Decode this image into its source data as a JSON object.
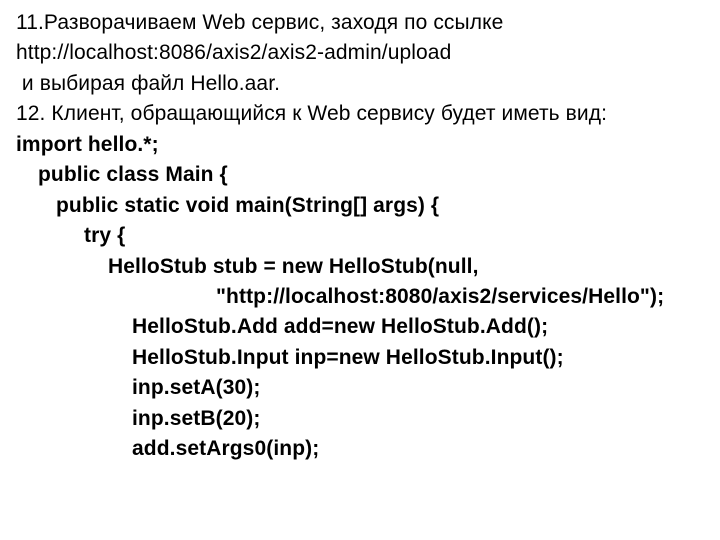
{
  "doc": {
    "line1": "11.Разворачиваем Web сервис, заходя по ссылке",
    "line2": "http://localhost:8086/axis2/axis2-admin/upload",
    "line3": " и выбирая файл Hello.aar.",
    "line4": "12. Клиент, обращающийся к Web сервису будет иметь вид:",
    "code": {
      "l1": "import hello.*;",
      "l2": "public class Main {",
      "l3": "public static void main(String[] args) {",
      "l4": "try {",
      "l5": "HelloStub stub = new HelloStub(null,",
      "l6": "\"http://localhost:8080/axis2/services/Hello\");",
      "l7": "HelloStub.Add add=new HelloStub.Add();",
      "l8": "HelloStub.Input inp=new HelloStub.Input();",
      "l9": "inp.setA(30);",
      "l10": "inp.setB(20);",
      "l11": "add.setArgs0(inp);"
    }
  }
}
